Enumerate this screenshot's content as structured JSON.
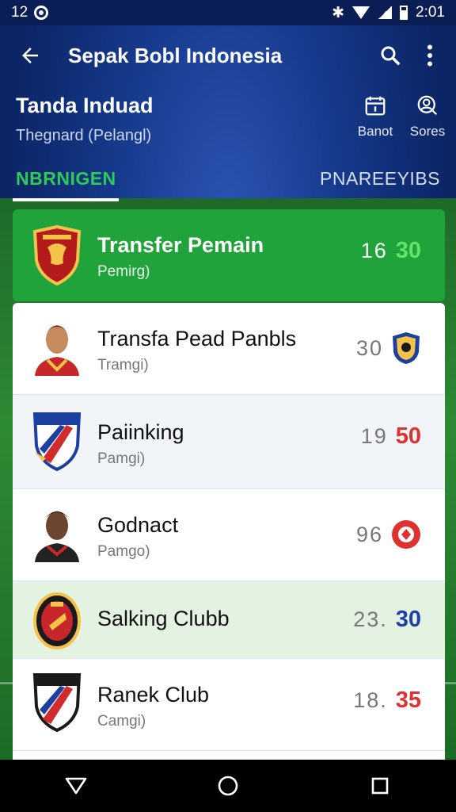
{
  "status_bar": {
    "time_left": "12",
    "time_right": "2:01"
  },
  "app_bar": {
    "title": "Sepak Bobl Indonesia",
    "icons": [
      "back-arrow-icon",
      "search-icon",
      "more-vert-icon"
    ]
  },
  "header": {
    "title": "Tanda Induad",
    "subtitle": "Thegnard (Pelangl)",
    "actions": [
      {
        "label": "Banot",
        "icon": "calendar-icon"
      },
      {
        "label": "Sores",
        "icon": "person-search-icon"
      }
    ]
  },
  "tabs": [
    {
      "label": "NBRNIGEN",
      "active": true
    },
    {
      "label": "PNAREEYIBS",
      "active": false
    }
  ],
  "featured": {
    "title": "Transfer Pemain",
    "subtitle": "Pemirg)",
    "num": "16",
    "big": "30"
  },
  "rows": [
    {
      "title": "Transfa Pead Panbls",
      "subtitle": "Tramgi)",
      "num": "30",
      "big": "",
      "badge": "club-badge-icon",
      "type": "player"
    },
    {
      "title": "Paiinking",
      "subtitle": "Pamgi)",
      "num": "19",
      "big": "50",
      "type": "club-stripes"
    },
    {
      "title": "Godnact",
      "subtitle": "Pamgo)",
      "num": "96",
      "big": "",
      "badge": "red-circle-badge-icon",
      "type": "player"
    },
    {
      "title": "Salking Clubb",
      "subtitle": "",
      "num": "23.",
      "big": "30",
      "type": "club-round"
    },
    {
      "title": "Ranek Club",
      "subtitle": "Camgi)",
      "num": "18.",
      "big": "35",
      "type": "club-stripes"
    }
  ],
  "colors": {
    "accent_green": "#1fa33a",
    "score_green": "#62e46a",
    "score_red": "#e03131",
    "score_blue": "#1f3fa8",
    "navy": "#0d2a6e"
  },
  "nav": [
    "back-triangle-icon",
    "home-circle-icon",
    "recents-square-icon"
  ]
}
